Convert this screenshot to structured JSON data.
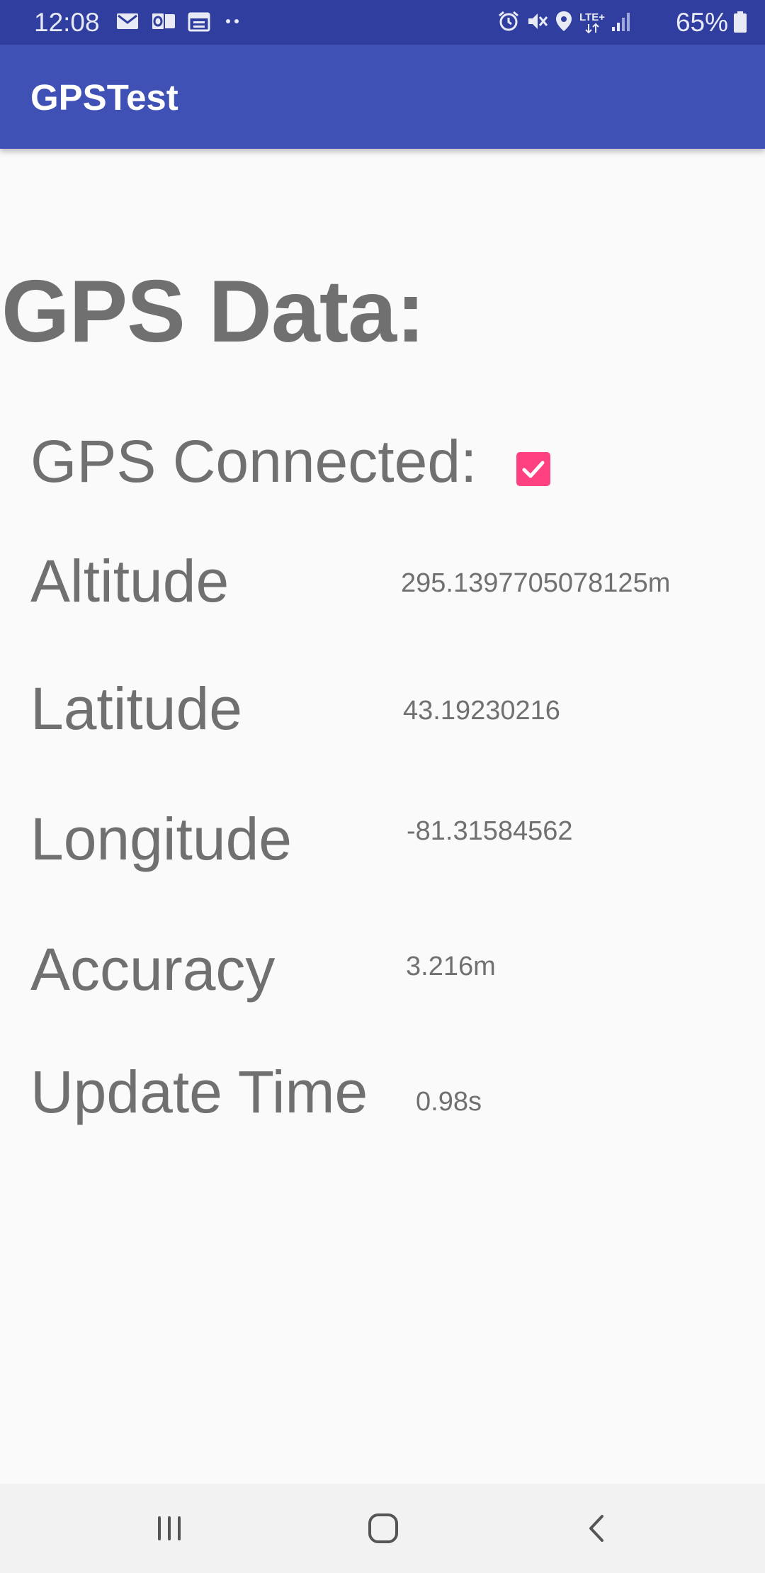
{
  "status_bar": {
    "time": "12:08",
    "left_icons": [
      "gmail-icon",
      "outlook-icon",
      "calendar-icon",
      "more-dots-icon"
    ],
    "right_icons": [
      "alarm-icon",
      "mute-icon",
      "location-icon",
      "lte-signal-icon",
      "cell-signal-icon"
    ],
    "network_label": "LTE+",
    "battery_percent": "65%",
    "battery_level": 0.65
  },
  "app_bar": {
    "title": "GPSTest"
  },
  "main": {
    "heading": "GPS Data:",
    "connected": {
      "label": "GPS Connected:",
      "checked": true,
      "accent_color": "#ff4081"
    },
    "rows": [
      {
        "label": "Altitude",
        "value": "295.1397705078125m"
      },
      {
        "label": "Latitude",
        "value": "43.19230216"
      },
      {
        "label": "Longitude",
        "value": "-81.31584562"
      },
      {
        "label": "Accuracy",
        "value": "3.216m"
      },
      {
        "label": "Update Time",
        "value": "0.98s"
      }
    ]
  },
  "nav_bar": {
    "buttons": [
      "recent-apps-icon",
      "home-icon",
      "back-icon"
    ]
  },
  "colors": {
    "status_bar": "#303f9f",
    "app_bar": "#3f51b5",
    "background": "#fafafa",
    "text": "#707070"
  }
}
